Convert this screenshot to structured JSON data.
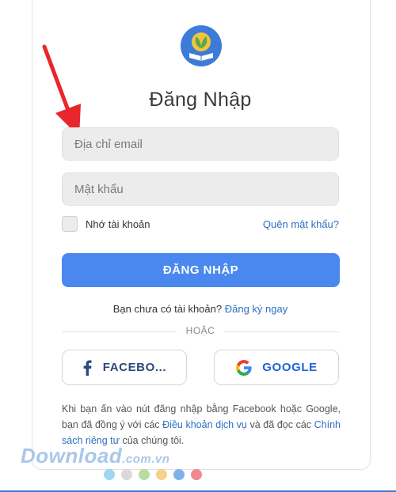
{
  "login": {
    "title": "Đăng Nhập",
    "email_placeholder": "Địa chỉ email",
    "password_placeholder": "Mật khẩu",
    "remember_label": "Nhớ tài khoản",
    "forgot_label": "Quên mật khẩu?",
    "login_button": "ĐĂNG NHẬP",
    "no_account_text": "Bạn chưa có tài khoản?",
    "signup_link": "Đăng ký ngay",
    "or_label": "HOẶC",
    "facebook_label": "FACEBO...",
    "google_label": "GOOGLE",
    "terms": {
      "part1": "Khi bạn ấn vào nút đăng nhập bằng Facebook hoặc Google, bạn đã đồng ý với các ",
      "terms_link": "Điều khoản dịch vụ",
      "part2": " và đã đọc các ",
      "privacy_link": "Chính sách riêng tư",
      "part3": " của chúng tôi."
    }
  },
  "watermark": {
    "brand": "Download",
    "domain": ".com.vn"
  },
  "colors": {
    "accent": "#4a88f0",
    "link": "#2f6fc2",
    "arrow": "#e8262b",
    "dots": [
      "#9fd6f2",
      "#d9d9d9",
      "#b8dca2",
      "#f6d28a",
      "#7fb3e8",
      "#ef8a8f"
    ]
  }
}
